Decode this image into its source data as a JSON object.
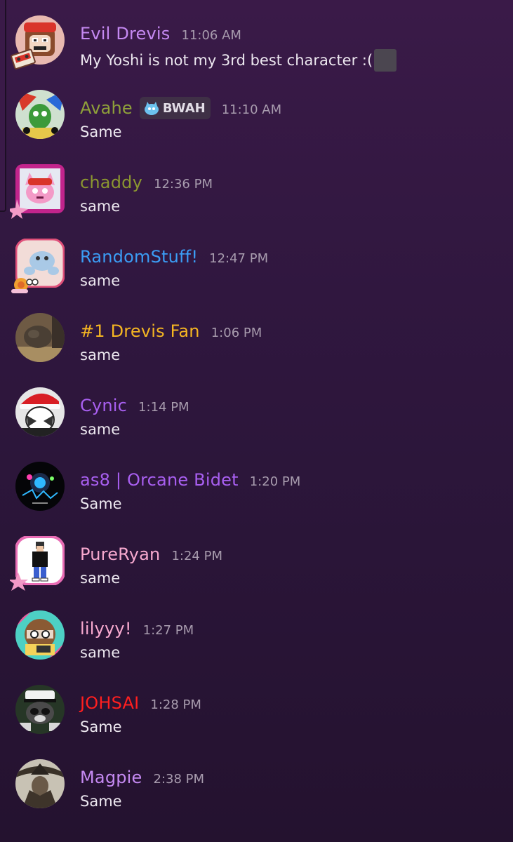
{
  "messages": [
    {
      "author": "Evil Drevis",
      "time": "11:06 AM",
      "text": "My Yoshi is not my 3rd best character :(",
      "color": "#c589f2",
      "avatar": "cartoon-monkey-avatar"
    },
    {
      "author": "Avahe",
      "time": "11:10 AM",
      "text": "Same",
      "color": "#8fa03a",
      "tag": "BWAH",
      "avatar": "cartoon-art-avatar"
    },
    {
      "author": "chaddy",
      "time": "12:36 PM",
      "text": "same",
      "color": "#8b9630",
      "avatar": "pink-cat-avatar"
    },
    {
      "author": "RandomStuff!",
      "time": "12:47 PM",
      "text": "same",
      "color": "#3b9df5",
      "avatar": "blue-creature-avatar"
    },
    {
      "author": "#1 Drevis Fan",
      "time": "1:06 PM",
      "text": "same",
      "color": "#f5b622",
      "avatar": "cat-photo-avatar"
    },
    {
      "author": "Cynic",
      "time": "1:14 PM",
      "text": "same",
      "color": "#a85ff0",
      "avatar": "santa-hat-avatar"
    },
    {
      "author": "as8 | Orcane Bidet",
      "time": "1:20 PM",
      "text": "Same",
      "color": "#a85ff0",
      "avatar": "dark-game-avatar"
    },
    {
      "author": "PureRyan",
      "time": "1:24 PM",
      "text": "same",
      "color": "#f7a9cf",
      "avatar": "pixel-person-avatar"
    },
    {
      "author": "lilyyy!",
      "time": "1:27 PM",
      "text": "same",
      "color": "#f7a9cf",
      "avatar": "drawn-girl-avatar"
    },
    {
      "author": "JOHSAI",
      "time": "1:28 PM",
      "text": "Same",
      "color": "#ff1f1f",
      "avatar": "captain-raccoon-avatar"
    },
    {
      "author": "Magpie",
      "time": "2:38 PM",
      "text": "Same",
      "color": "#c589f2",
      "avatar": "dark-fantasy-avatar"
    }
  ]
}
